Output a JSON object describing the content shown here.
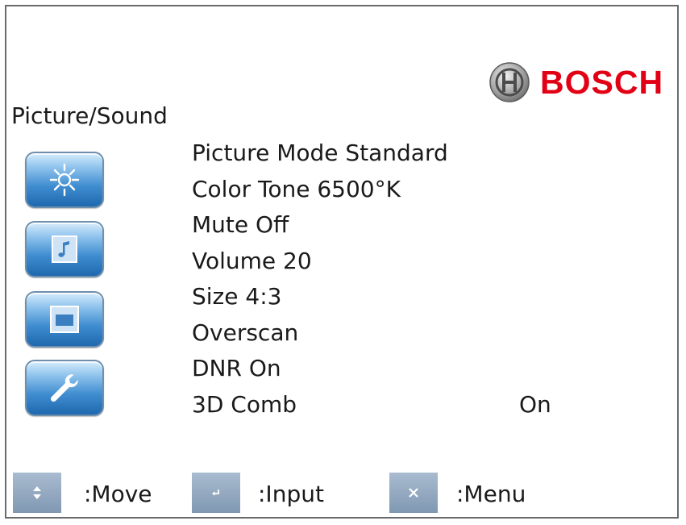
{
  "brand": {
    "name": "BOSCH",
    "color": "#e20015"
  },
  "menu": {
    "title": "Picture/Sound",
    "items": [
      {
        "label": "Picture Mode Standard",
        "value": ""
      },
      {
        "label": "Color Tone 6500°K",
        "value": ""
      },
      {
        "label": "Mute Off",
        "value": ""
      },
      {
        "label": "Volume 20",
        "value": ""
      },
      {
        "label": "Size 4:3",
        "value": ""
      },
      {
        "label": "Overscan",
        "value": ""
      },
      {
        "label": "DNR On",
        "value": ""
      },
      {
        "label": "3D Comb",
        "value": "On"
      }
    ]
  },
  "side_buttons": [
    {
      "icon": "sun-brightness-icon"
    },
    {
      "icon": "music-note-icon"
    },
    {
      "icon": "screen-size-icon"
    },
    {
      "icon": "wrench-icon"
    }
  ],
  "legend": {
    "move": {
      "label": ":Move",
      "icon": "up-down-arrows-icon"
    },
    "input": {
      "label": ":Input",
      "icon": "enter-return-icon"
    },
    "menu": {
      "label": ":Menu",
      "icon": "close-x-icon"
    }
  },
  "colors": {
    "button_blue": "#3f8dd0",
    "legend_key": "#8a9fb8",
    "frame": "#6a6a6a"
  }
}
